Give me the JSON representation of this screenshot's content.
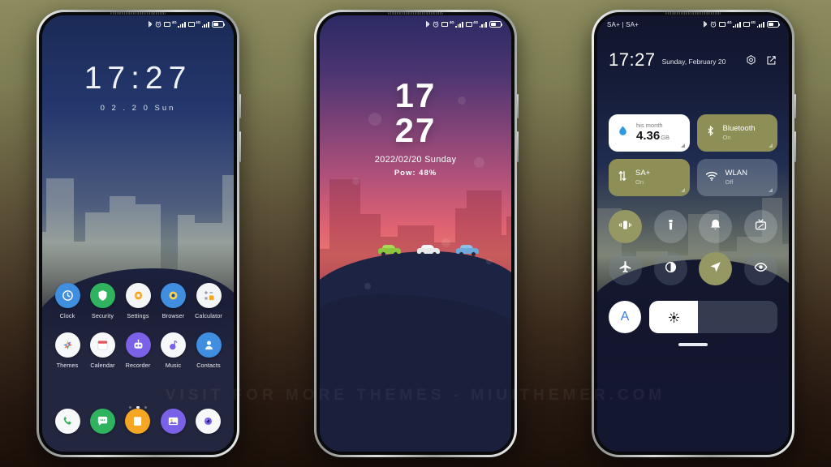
{
  "watermark": "VISIT FOR MORE THEMES - MIUITHEMER.COM",
  "colors": {
    "background_top": "#8d8c5e",
    "background_bottom": "#1b1009",
    "accent_olive": "#8d8f56",
    "accent_blue": "#3b7de0",
    "frame_silver": "#d9dddb"
  },
  "phone1": {
    "name": "lockscreen-preview",
    "statusbar": {
      "icons": [
        "bluetooth-icon",
        "alarm-icon",
        "sim1-icon",
        "signal-bars-icon",
        "sim2-icon",
        "signal-bars-icon",
        "battery-icon"
      ],
      "network_label": "4G",
      "battery_percent": 45
    },
    "clock": {
      "time": "17:27",
      "date": "0 2 . 2 0   Sun"
    },
    "page_dots": {
      "count": 3,
      "active_index": 1
    },
    "apps": [
      [
        {
          "label": "Clock",
          "icon": "clock-icon",
          "bg": "#3f8ee0",
          "fg": "#ffffff"
        },
        {
          "label": "Security",
          "icon": "shield-icon",
          "bg": "#2fb35f",
          "fg": "#ffffff"
        },
        {
          "label": "Settings",
          "icon": "gear-icon",
          "bg": "#f4f5f7",
          "fg": "#f5a623"
        },
        {
          "label": "Browser",
          "icon": "compass-icon",
          "bg": "#3f8ee0",
          "fg": "#ffd24a"
        },
        {
          "label": "Calculator",
          "icon": "calculator-icon",
          "bg": "#f4f5f7",
          "fg": "#f5a623"
        }
      ],
      [
        {
          "label": "Themes",
          "icon": "flower-icon",
          "bg": "#f7f8fa",
          "fg": "#4a90d9"
        },
        {
          "label": "Calendar",
          "icon": "calendar-icon",
          "bg": "#f7f8fa",
          "fg": "#e8525b"
        },
        {
          "label": "Recorder",
          "icon": "robot-icon",
          "bg": "#7b61e8",
          "fg": "#ffffff"
        },
        {
          "label": "Music",
          "icon": "music-note-icon",
          "bg": "#f7f8fa",
          "fg": "#7b61e8"
        },
        {
          "label": "Contacts",
          "icon": "person-icon",
          "bg": "#3f8ee0",
          "fg": "#ffffff"
        }
      ]
    ],
    "dock": [
      {
        "label": "Phone",
        "icon": "phone-icon",
        "bg": "#f7f8fa",
        "fg": "#2fb35f"
      },
      {
        "label": "Messages",
        "icon": "message-icon",
        "bg": "#2fb35f",
        "fg": "#ffffff"
      },
      {
        "label": "Notes",
        "icon": "notes-icon",
        "bg": "#f5a623",
        "fg": "#ffffff"
      },
      {
        "label": "Gallery",
        "icon": "photo-icon",
        "bg": "#7b61e8",
        "fg": "#ffffff"
      },
      {
        "label": "Camera",
        "icon": "camera-icon",
        "bg": "#f7f8fa",
        "fg": "#7b61e8"
      }
    ]
  },
  "phone2": {
    "name": "aod-clock-preview",
    "statusbar": {
      "icons": [
        "bluetooth-icon",
        "alarm-icon",
        "sim1-icon",
        "signal-bars-icon",
        "sim2-icon",
        "signal-bars-icon",
        "battery-icon"
      ],
      "network_label": "4G",
      "battery_percent": 48
    },
    "clock": {
      "hours": "17",
      "minutes": "27",
      "date": "2022/02/20 Sunday",
      "power_label": "Pow:",
      "power_value": "48%"
    },
    "cars": [
      {
        "name": "car-green",
        "body": "#8cc63f",
        "top": "#a8d957"
      },
      {
        "name": "car-white",
        "body": "#e8eaec",
        "top": "#f4f6f7"
      },
      {
        "name": "car-blue",
        "body": "#6fa8dc",
        "top": "#8fc0e8"
      }
    ]
  },
  "phone3": {
    "name": "control-center-preview",
    "statusbar": {
      "carrier": "SA+ | SA+",
      "icons": [
        "bluetooth-icon",
        "alarm-icon",
        "sim1-icon",
        "signal-bars-icon",
        "sim2-icon",
        "signal-bars-icon",
        "battery-icon"
      ],
      "network_label": "4G",
      "battery_percent": 45
    },
    "header": {
      "time": "17:27",
      "date": "Sunday, February 20",
      "settings_icon": "gear-icon",
      "edit_icon": "edit-icon"
    },
    "tiles": [
      {
        "name": "data-usage-tile",
        "icon": "water-drop-icon",
        "title": "his month",
        "value": "4.36",
        "unit": "GB",
        "style": "white"
      },
      {
        "name": "bluetooth-tile",
        "icon": "bluetooth-icon",
        "label": "Bluetooth",
        "state": "On",
        "style": "olive"
      },
      {
        "name": "mobile-data-tile",
        "icon": "data-arrows-icon",
        "label": "SA+",
        "state": "On",
        "style": "olive"
      },
      {
        "name": "wlan-tile",
        "icon": "wifi-icon",
        "label": "WLAN",
        "state": "Off",
        "style": "glass"
      }
    ],
    "toggles_row1": [
      {
        "name": "vibrate-toggle",
        "icon": "vibrate-icon",
        "active": true
      },
      {
        "name": "flashlight-toggle",
        "icon": "flashlight-icon",
        "active": false
      },
      {
        "name": "ring-toggle",
        "icon": "bell-icon",
        "active": false
      },
      {
        "name": "screenshot-toggle",
        "icon": "screenshot-icon",
        "active": false
      }
    ],
    "toggles_row2": [
      {
        "name": "airplane-toggle",
        "icon": "airplane-icon",
        "active": false
      },
      {
        "name": "dark-mode-toggle",
        "icon": "contrast-icon",
        "active": false
      },
      {
        "name": "location-toggle",
        "icon": "location-arrow-icon",
        "active": true
      },
      {
        "name": "eye-care-toggle",
        "icon": "eye-icon",
        "active": false
      }
    ],
    "brightness": {
      "auto_label": "A",
      "auto_icon": "auto-brightness-icon",
      "slider_icon": "sun-icon",
      "level_percent": 38
    }
  }
}
